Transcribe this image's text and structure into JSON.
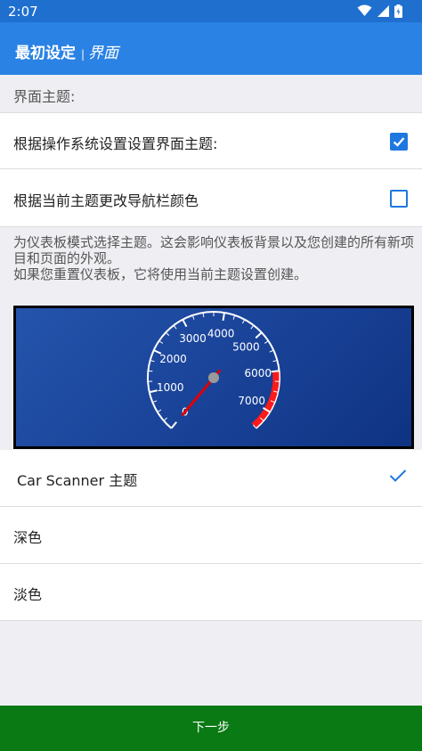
{
  "status_bar": {
    "time": "2:07"
  },
  "app_bar": {
    "title": "最初设定",
    "separator": "|",
    "subtitle": "界面"
  },
  "section_header": "界面主题:",
  "options": [
    {
      "label": "根据操作系统设置设置界面主题:",
      "checked": true
    },
    {
      "label": "根据当前主题更改导航栏颜色",
      "checked": false
    }
  ],
  "description": "为仪表板模式选择主题。这会影响仪表板背景以及您创建的所有新项目和页面的外观。\n如果您重置仪表板，它将使用当前主题设置创建。",
  "gauge": {
    "tick_labels": [
      "0",
      "1000",
      "2000",
      "3000",
      "4000",
      "5000",
      "6000",
      "7000"
    ],
    "min": 0,
    "max": 7500,
    "value": 0,
    "redline_start": 6000,
    "colors": {
      "background": "#1b459b",
      "needle": "#e00000",
      "redline": "#ff1a1a",
      "ticks": "#ffffff"
    }
  },
  "themes": [
    {
      "label": "Car Scanner 主题",
      "selected": true
    },
    {
      "label": "深色",
      "selected": false
    },
    {
      "label": "淡色",
      "selected": false
    }
  ],
  "next_button": {
    "label": "下一步"
  },
  "colors": {
    "appbar": "#2a82e4",
    "statusbar": "#1f6fcf",
    "accent": "#1e78e0",
    "next_button": "#0a7a14"
  }
}
